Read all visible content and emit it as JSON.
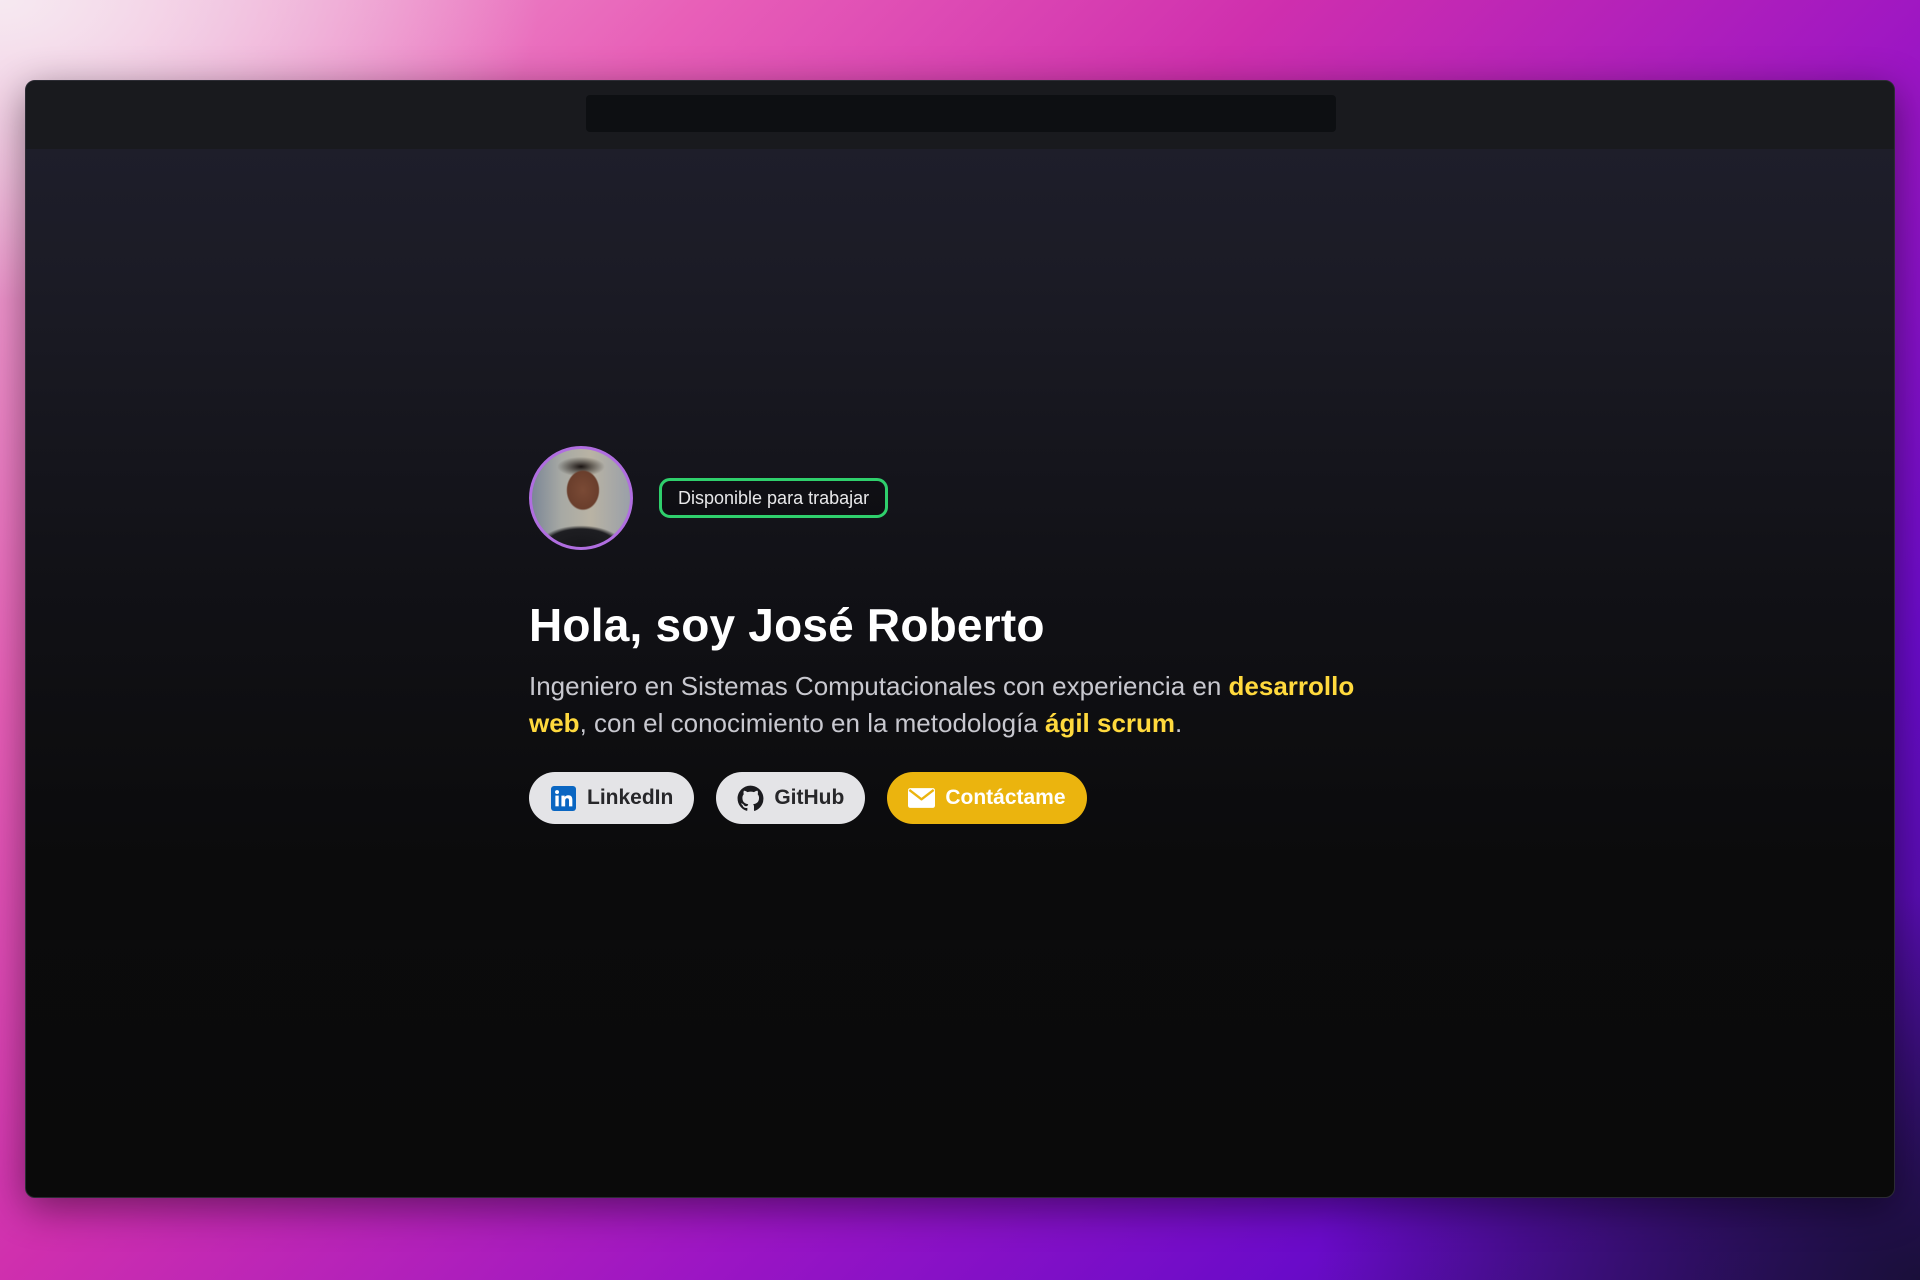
{
  "hero": {
    "badge": "Disponible para trabajar",
    "title": "Hola, soy José Roberto",
    "description": {
      "part1": "Ingeniero en Sistemas Computacionales con experiencia en ",
      "highlight1": "desarrollo web",
      "part2": ", con el conocimiento en la metodología ",
      "highlight2": "ágil scrum",
      "part3": "."
    },
    "buttons": {
      "linkedin": "LinkedIn",
      "github": "GitHub",
      "contact": "Contáctame"
    }
  },
  "colors": {
    "accent": "#ffd93d",
    "badge_border": "#2fcf6c",
    "avatar_border": "#b06ee0",
    "contact_button": "#ebb40e",
    "linkedin_blue": "#0a66c2"
  },
  "icons": {
    "linkedin": "linkedin-icon",
    "github": "github-icon",
    "contact": "mail-icon"
  }
}
